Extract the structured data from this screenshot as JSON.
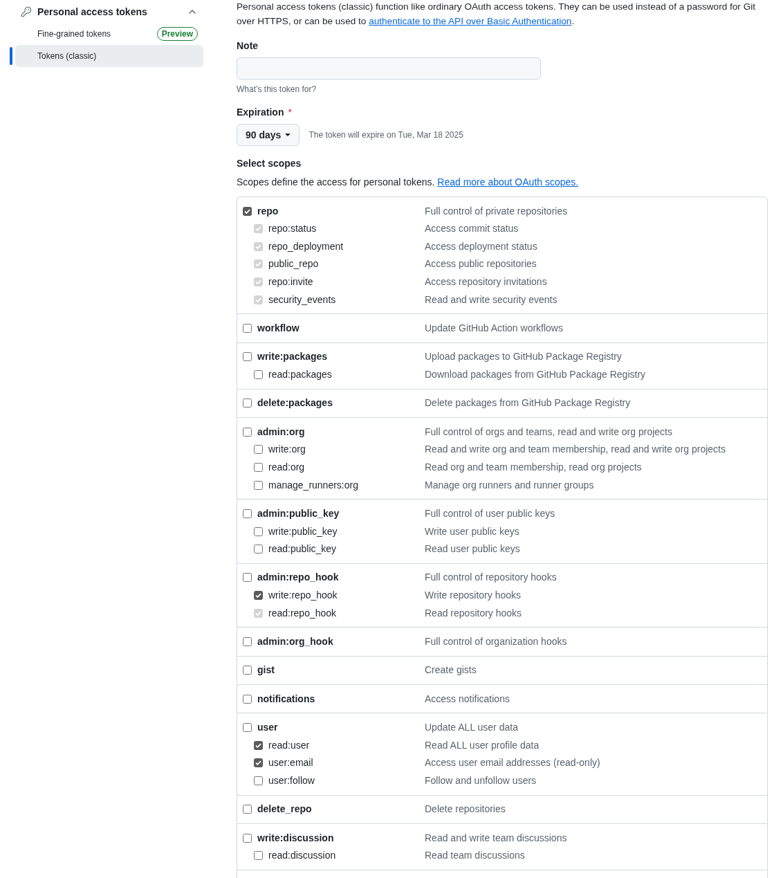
{
  "sidebar": {
    "section": {
      "title": "Personal access tokens",
      "expanded": true,
      "items": [
        {
          "label": "Fine-grained tokens",
          "badge": "Preview",
          "selected": false
        },
        {
          "label": "Tokens (classic)",
          "selected": true
        }
      ]
    }
  },
  "intro": {
    "text": "Personal access tokens (classic) function like ordinary OAuth access tokens. They can be used instead of a password for Git over HTTPS, or can be used to ",
    "link": "authenticate to the API over Basic Authentication",
    "after": "."
  },
  "note": {
    "label": "Note",
    "hint": "What’s this token for?"
  },
  "expiration": {
    "label": "Expiration",
    "required": true,
    "required_mark": "*",
    "value": "90 days",
    "caption": "The token will expire on Tue, Mar 18 2025"
  },
  "scopes": {
    "title": "Select scopes",
    "description": "Scopes define the access for personal tokens.",
    "link": "Read more about OAuth scopes.",
    "groups": [
      {
        "name": "repo",
        "description": "Full control of private repositories",
        "checked": true,
        "disabled": false,
        "children": [
          {
            "name": "repo:status",
            "description": "Access commit status",
            "checked": true,
            "disabled": true
          },
          {
            "name": "repo_deployment",
            "description": "Access deployment status",
            "checked": true,
            "disabled": true
          },
          {
            "name": "public_repo",
            "description": "Access public repositories",
            "checked": true,
            "disabled": true
          },
          {
            "name": "repo:invite",
            "description": "Access repository invitations",
            "checked": true,
            "disabled": true
          },
          {
            "name": "security_events",
            "description": "Read and write security events",
            "checked": true,
            "disabled": true
          }
        ]
      },
      {
        "name": "workflow",
        "description": "Update GitHub Action workflows",
        "checked": false,
        "disabled": false
      },
      {
        "name": "write:packages",
        "description": "Upload packages to GitHub Package Registry",
        "checked": false,
        "disabled": false,
        "children": [
          {
            "name": "read:packages",
            "description": "Download packages from GitHub Package Registry",
            "checked": false,
            "disabled": false
          }
        ]
      },
      {
        "name": "delete:packages",
        "description": "Delete packages from GitHub Package Registry",
        "checked": false,
        "disabled": false
      },
      {
        "name": "admin:org",
        "description": "Full control of orgs and teams, read and write org projects",
        "checked": false,
        "disabled": false,
        "children": [
          {
            "name": "write:org",
            "description": "Read and write org and team membership, read and write org projects",
            "checked": false,
            "disabled": false
          },
          {
            "name": "read:org",
            "description": "Read org and team membership, read org projects",
            "checked": false,
            "disabled": false
          },
          {
            "name": "manage_runners:org",
            "description": "Manage org runners and runner groups",
            "checked": false,
            "disabled": false
          }
        ]
      },
      {
        "name": "admin:public_key",
        "description": "Full control of user public keys",
        "checked": false,
        "disabled": false,
        "children": [
          {
            "name": "write:public_key",
            "description": "Write user public keys",
            "checked": false,
            "disabled": false
          },
          {
            "name": "read:public_key",
            "description": "Read user public keys",
            "checked": false,
            "disabled": false
          }
        ]
      },
      {
        "name": "admin:repo_hook",
        "description": "Full control of repository hooks",
        "checked": false,
        "disabled": false,
        "children": [
          {
            "name": "write:repo_hook",
            "description": "Write repository hooks",
            "checked": true,
            "disabled": false
          },
          {
            "name": "read:repo_hook",
            "description": "Read repository hooks",
            "checked": true,
            "disabled": true
          }
        ]
      },
      {
        "name": "admin:org_hook",
        "description": "Full control of organization hooks",
        "checked": false,
        "disabled": false
      },
      {
        "name": "gist",
        "description": "Create gists",
        "checked": false,
        "disabled": false
      },
      {
        "name": "notifications",
        "description": "Access notifications",
        "checked": false,
        "disabled": false
      },
      {
        "name": "user",
        "description": "Update ALL user data",
        "checked": false,
        "disabled": false,
        "children": [
          {
            "name": "read:user",
            "description": "Read ALL user profile data",
            "checked": true,
            "disabled": false
          },
          {
            "name": "user:email",
            "description": "Access user email addresses (read-only)",
            "checked": true,
            "disabled": false
          },
          {
            "name": "user:follow",
            "description": "Follow and unfollow users",
            "checked": false,
            "disabled": false
          }
        ]
      },
      {
        "name": "delete_repo",
        "description": "Delete repositories",
        "checked": false,
        "disabled": false
      },
      {
        "name": "write:discussion",
        "description": "Read and write team discussions",
        "checked": false,
        "disabled": false,
        "children": [
          {
            "name": "read:discussion",
            "description": "Read team discussions",
            "checked": false,
            "disabled": false
          }
        ]
      }
    ]
  }
}
